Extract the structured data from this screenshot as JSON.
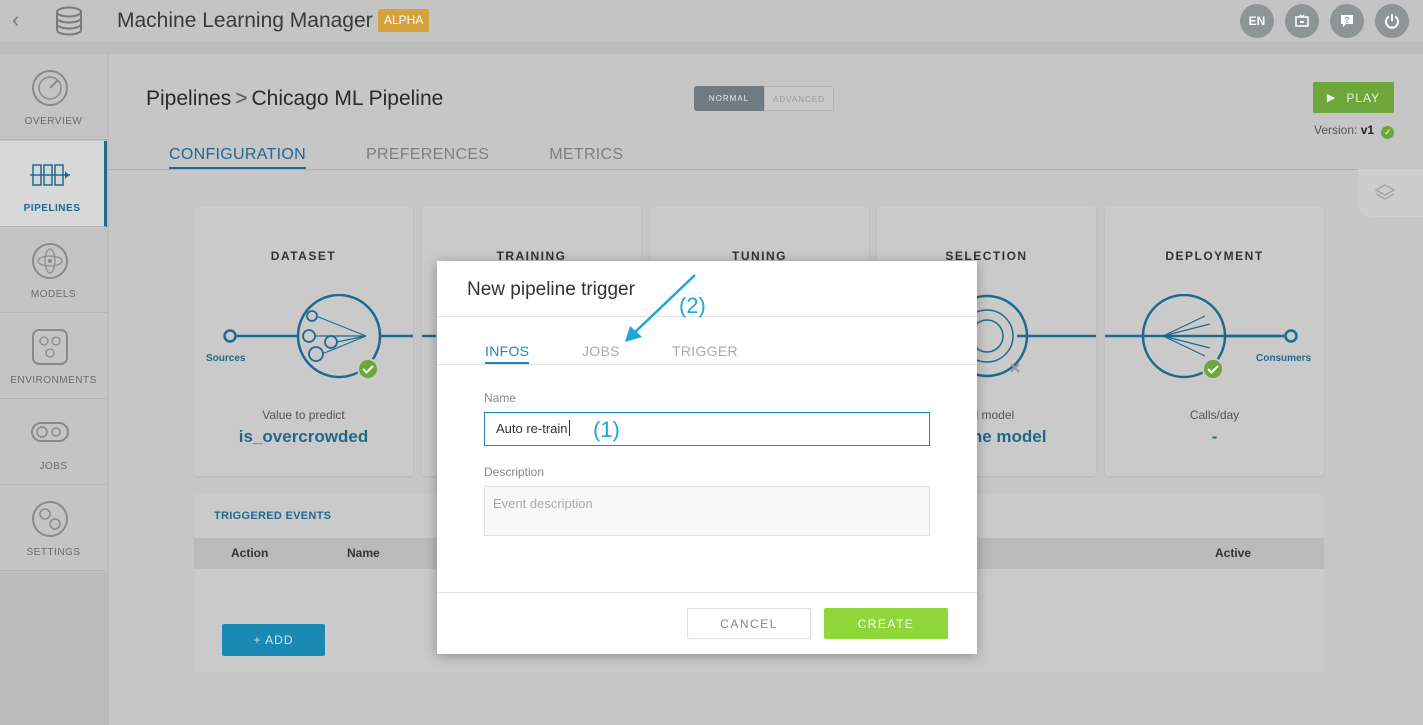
{
  "app": {
    "title": "Machine Learning Manager",
    "badge": "ALPHA",
    "back_icon": "chevron-left-icon",
    "logo_icon": "database-icon"
  },
  "topbar": {
    "lang": "EN",
    "icons": [
      "language-icon",
      "presentation-icon",
      "help-chat-icon",
      "power-icon"
    ]
  },
  "sidebar": {
    "items": [
      {
        "label": "OVERVIEW",
        "icon": "gauge-icon",
        "active": false
      },
      {
        "label": "PIPELINES",
        "icon": "pipeline-icon",
        "active": true
      },
      {
        "label": "MODELS",
        "icon": "atom-icon",
        "active": false
      },
      {
        "label": "ENVIRONMENTS",
        "icon": "hexagon-network-icon",
        "active": false
      },
      {
        "label": "JOBS",
        "icon": "gears-icon",
        "active": false
      },
      {
        "label": "SETTINGS",
        "icon": "settings-gears-icon",
        "active": false
      }
    ]
  },
  "header": {
    "breadcrumb_root": "Pipelines",
    "breadcrumb_sep": ">",
    "breadcrumb_current": "Chicago ML Pipeline",
    "mode_normal": "NORMAL",
    "mode_advanced": "ADVANCED",
    "play_label": "PLAY",
    "version_label": "Version:",
    "version_value": "v1"
  },
  "tabs": [
    "CONFIGURATION",
    "PREFERENCES",
    "METRICS"
  ],
  "stages": [
    {
      "title": "DATASET",
      "sub": "Value to predict",
      "value": "is_overcrowded"
    },
    {
      "title": "TRAINING",
      "sub": "",
      "value": ""
    },
    {
      "title": "TUNING",
      "sub": "",
      "value": ""
    },
    {
      "title": "SELECTION",
      "sub": "ved model",
      "value": "Pipeline model"
    },
    {
      "title": "DEPLOYMENT",
      "sub": "Calls/day",
      "value": "-"
    }
  ],
  "flow": {
    "sources": "Sources",
    "consumers": "Consumers"
  },
  "events": {
    "title": "TRIGGERED EVENTS",
    "columns": [
      "Action",
      "Name",
      "Active"
    ],
    "add_label": "+ ADD"
  },
  "modal": {
    "title": "New pipeline trigger",
    "tabs": [
      "INFOS",
      "JOBS",
      "TRIGGER"
    ],
    "name_label": "Name",
    "name_value": "Auto re-train",
    "description_label": "Description",
    "description_placeholder": "Event description",
    "cancel_label": "CANCEL",
    "create_label": "CREATE"
  },
  "annotations": {
    "one": "(1)",
    "two": "(2)"
  },
  "colors": {
    "primary": "#1e6a8e",
    "accent": "#1e88b4",
    "play": "#6da63a",
    "create": "#8fd63a",
    "badge": "#d4a13c",
    "annotation": "#1fa5d6"
  }
}
